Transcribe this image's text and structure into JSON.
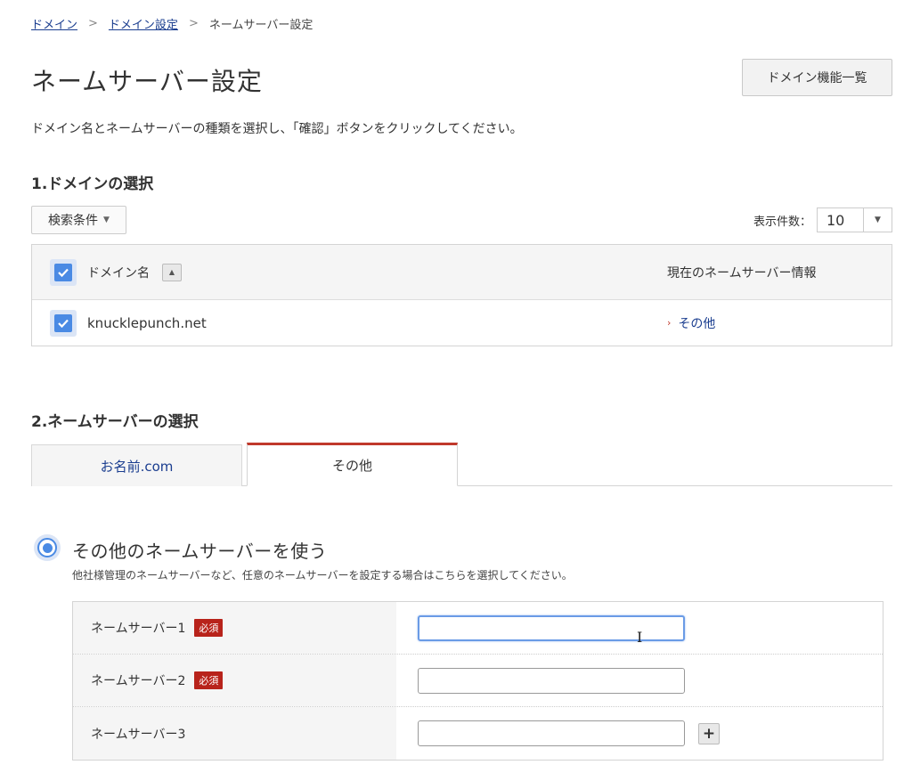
{
  "breadcrumb": {
    "items": [
      "ドメイン",
      "ドメイン設定"
    ],
    "separator": ">",
    "current": "ネームサーバー設定"
  },
  "page": {
    "title": "ネームサーバー設定",
    "features_button": "ドメイン機能一覧",
    "intro": "ドメイン名とネームサーバーの種類を選択し、「確認」ボタンをクリックしてください。"
  },
  "section1": {
    "heading": "1.ドメインの選択",
    "search_conditions": "検索条件",
    "page_size_label": "表示件数：",
    "page_size_value": "10",
    "table": {
      "col_domain": "ドメイン名",
      "col_ns": "現在のネームサーバー情報",
      "rows": [
        {
          "domain": "knucklepunch.net",
          "ns": "その他",
          "checked": true
        }
      ],
      "header_checked": true
    }
  },
  "section2": {
    "heading": "2.ネームサーバーの選択",
    "tabs": [
      {
        "label": "お名前.com",
        "active": false
      },
      {
        "label": "その他",
        "active": true
      }
    ],
    "radio_label": "その他のネームサーバーを使う",
    "radio_selected": true,
    "radio_desc": "他社様管理のネームサーバーなど、任意のネームサーバーを設定する場合はこちらを選択してください。",
    "nameservers": [
      {
        "label": "ネームサーバー1",
        "required": true,
        "required_label": "必須",
        "value": ""
      },
      {
        "label": "ネームサーバー2",
        "required": true,
        "required_label": "必須",
        "value": ""
      },
      {
        "label": "ネームサーバー3",
        "required": false,
        "value": ""
      }
    ],
    "add_button": "+"
  },
  "colors": {
    "link": "#1a3d8f",
    "accent_red": "#c0392b",
    "checkbox_blue": "#4a8ae4",
    "required_badge": "#b8231b"
  },
  "icons": {
    "breadcrumb_separator": "chevron-right-icon",
    "dropdown": "caret-down-icon",
    "sort": "sort-up-icon",
    "link_chevron": "chevron-right-icon",
    "add": "plus-icon",
    "cursor": "text-cursor-icon"
  }
}
